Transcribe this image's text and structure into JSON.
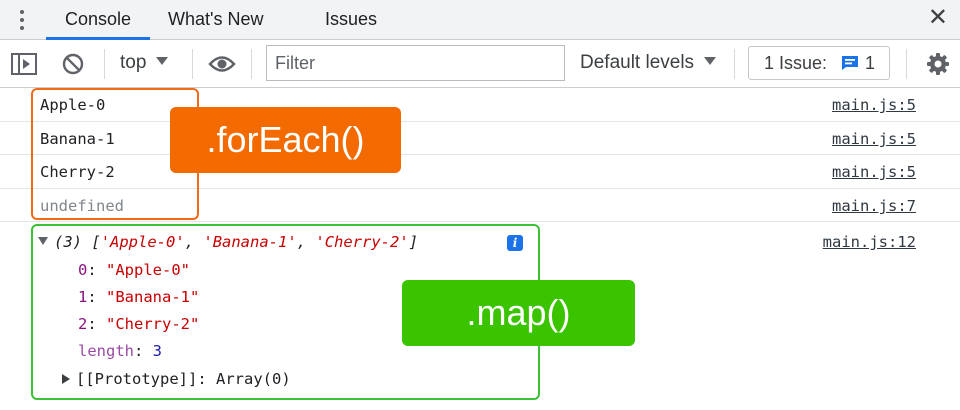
{
  "tabs": [
    {
      "label": "Console",
      "active": true
    },
    {
      "label": "What's New",
      "active": false
    },
    {
      "label": "Issues",
      "active": false
    }
  ],
  "toolbar": {
    "context": "top",
    "filter_placeholder": "Filter",
    "levels": "Default levels",
    "issue_label": "1 Issue:",
    "issue_count": "1"
  },
  "console": {
    "rows": [
      {
        "text": "Apple-0",
        "source": "main.js:5"
      },
      {
        "text": "Banana-1",
        "source": "main.js:5"
      },
      {
        "text": "Cherry-2",
        "source": "main.js:5"
      },
      {
        "text": "undefined",
        "source": "main.js:7"
      }
    ],
    "array": {
      "source": "main.js:12",
      "length_prefix": "(3)",
      "summary_open": "[",
      "summary_items": [
        "'Apple-0'",
        "'Banana-1'",
        "'Cherry-2'"
      ],
      "summary_close": "]",
      "entries": [
        {
          "key": "0",
          "value": "\"Apple-0\""
        },
        {
          "key": "1",
          "value": "\"Banana-1\""
        },
        {
          "key": "2",
          "value": "\"Cherry-2\""
        }
      ],
      "length_key": "length",
      "length_value": "3",
      "prototype_key": "[[Prototype]]",
      "prototype_value": "Array(0)"
    }
  },
  "annotations": {
    "foreach": ".forEach()",
    "map": ".map()"
  },
  "colors": {
    "accent": "#1a73e8",
    "foreach_tag": "#f26a00",
    "map_tag": "#3ac400"
  }
}
